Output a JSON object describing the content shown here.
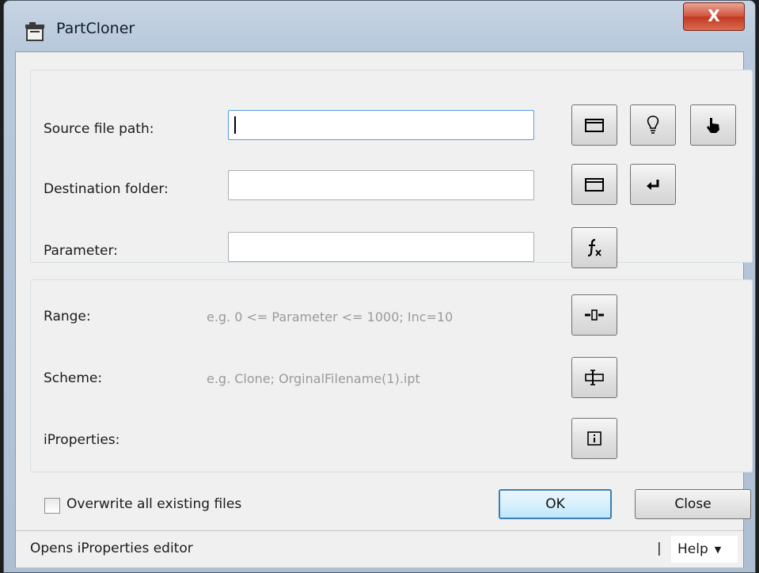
{
  "window": {
    "title": "PartCloner",
    "close_glyph": "X"
  },
  "source": {
    "label": "Source file path:",
    "value": "",
    "buttons": [
      "folder-icon",
      "lightbulb-icon",
      "pointer-hand-icon"
    ]
  },
  "destination": {
    "label": "Destination folder:",
    "value": "",
    "buttons": [
      "folder-icon",
      "enter-arrow-icon"
    ]
  },
  "parameter": {
    "label": "Parameter:",
    "value": "",
    "buttons": [
      "function-fx-icon"
    ]
  },
  "range": {
    "label": "Range:",
    "hint": "e.g. 0 <= Parameter <= 1000; Inc=10",
    "buttons": [
      "range-slider-icon"
    ]
  },
  "scheme": {
    "label": "Scheme:",
    "hint": "e.g. Clone; OrginalFilename(1).ipt",
    "buttons": [
      "text-cursor-icon"
    ]
  },
  "iproperties": {
    "label": "iProperties:",
    "buttons": [
      "info-icon"
    ]
  },
  "footer": {
    "overwrite_label": "Overwrite all existing files",
    "overwrite_checked": false,
    "ok_label": "OK",
    "close_label": "Close"
  },
  "status": {
    "text": "Opens iProperties editor",
    "separator": "|",
    "help_label": "Help",
    "help_arrow": "▼"
  }
}
